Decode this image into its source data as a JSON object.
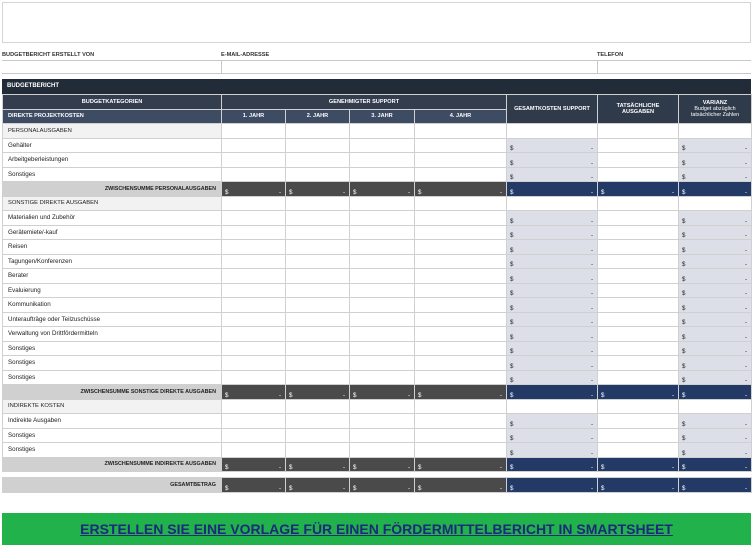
{
  "info": {
    "created_by_label": "BUDGETBERICHT ERSTELLT VON",
    "email_label": "E-MAIL-ADRESSE",
    "phone_label": "TELEFON"
  },
  "report_title": "BUDGETBERICHT",
  "headers": {
    "categories": "BUDGETKATEGORIEN",
    "approved_support": "GENEHMIGTER SUPPORT",
    "total_cost": "GESAMTKOSTEN SUPPORT",
    "actual_spend": "TATSÄCHLICHE AUSGABEN",
    "variance": "VARIANZ",
    "variance_sub": "Budget abzüglich tatsächlicher Zahlen",
    "direct_costs": "DIREKTE PROJEKTKOSTEN",
    "year1": "1. JAHR",
    "year2": "2. JAHR",
    "year3": "3. JAHR",
    "year4": "4. JAHR"
  },
  "currency": "$",
  "dash": "-",
  "sections": [
    {
      "title": "PERSONALAUSGABEN",
      "items": [
        "Gehälter",
        "Arbeitgeberleistungen",
        "Sonstiges"
      ],
      "subtotal": "ZWISCHENSUMME PERSONALAUSGABEN"
    },
    {
      "title": "SONSTIGE DIREKTE AUSGABEN",
      "items": [
        "Materialien und Zubehör",
        "Gerätemiete/-kauf",
        "Reisen",
        "Tagungen/Konferenzen",
        "Berater",
        "Evaluierung",
        "Kommunikation",
        "Unteraufträge oder Teilzuschüsse",
        "Verwaltung von Drittfördermitteln",
        "Sonstiges",
        "Sonstiges",
        "Sonstiges"
      ],
      "subtotal": "ZWISCHENSUMME SONSTIGE DIREKTE AUSGABEN"
    },
    {
      "title": "INDIREKTE KOSTEN",
      "items": [
        "Indirekte Ausgaben",
        "Sonstiges",
        "Sonstiges"
      ],
      "subtotal": "ZWISCHENSUMME INDIREKTE AUSGABEN"
    }
  ],
  "grand_total": "GESAMTBETRAG",
  "banner_text": "ERSTELLEN SIE EINE VORLAGE FÜR EINEN FÖRDERMITTELBERICHT IN SMARTSHEET"
}
